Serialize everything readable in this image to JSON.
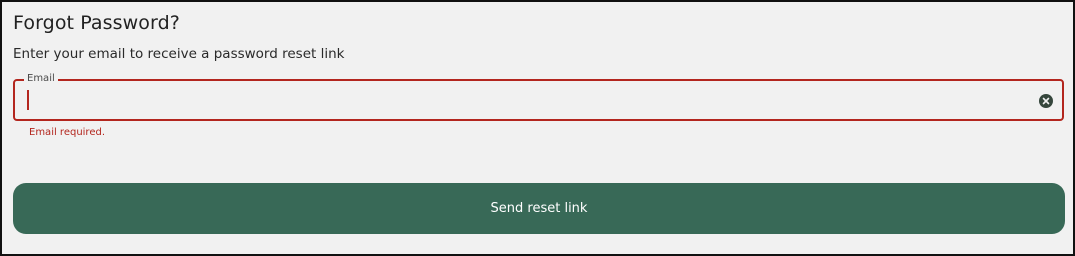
{
  "form": {
    "title": "Forgot Password?",
    "subtitle": "Enter your email to receive a password reset link",
    "email": {
      "label": "Email",
      "value": "",
      "error": "Email required."
    },
    "submit_label": "Send reset link"
  },
  "icons": {
    "clear": "close-circle-icon"
  },
  "colors": {
    "background": "#f1f1f1",
    "accent": "#386957",
    "error": "#b3261e",
    "clear_icon": "#35463c"
  }
}
